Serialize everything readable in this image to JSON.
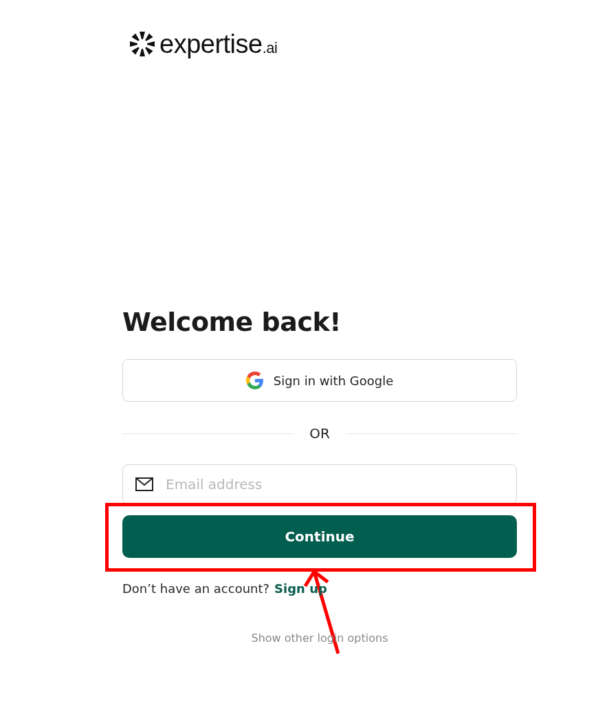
{
  "logo": {
    "name": "expertise",
    "suffix": ".ai"
  },
  "heading": "Welcome back!",
  "google_button": {
    "label": "Sign in with Google"
  },
  "divider": {
    "label": "OR"
  },
  "email_field": {
    "placeholder": "Email address"
  },
  "continue_button": {
    "label": "Continue"
  },
  "signup": {
    "text": "Don’t have an account?",
    "link": "Sign up"
  },
  "other_options": {
    "label": "Show other login options"
  },
  "annotation": {
    "highlight": true
  }
}
